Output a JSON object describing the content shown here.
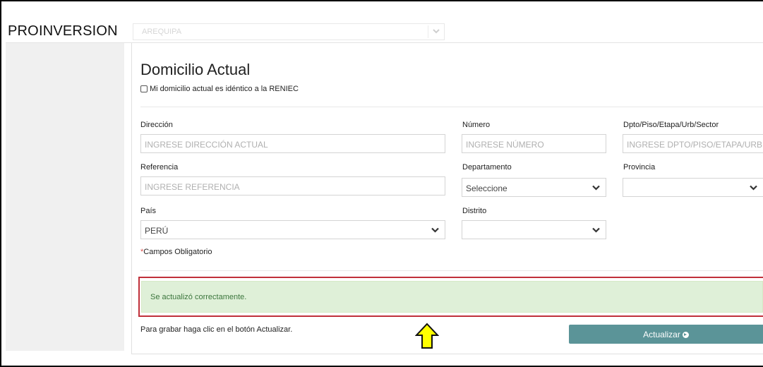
{
  "header": {
    "logo": "PROINVERSION",
    "top_select_value": "AREQUIPA"
  },
  "section": {
    "title": "Domicilio Actual",
    "checkbox_label": "Mi domicilio actual es idéntico a la RENIEC",
    "checkbox_checked": false
  },
  "form": {
    "direccion": {
      "label": "Dirección",
      "placeholder": "INGRESE DIRECCIÓN ACTUAL"
    },
    "numero": {
      "label": "Número",
      "placeholder": "INGRESE NÚMERO"
    },
    "dpto": {
      "label": "Dpto/Piso/Etapa/Urb/Sector",
      "placeholder": "INGRESE DPTO/PISO/ETAPA/URB Ó SECTOR"
    },
    "referencia": {
      "label": "Referencia",
      "placeholder": "INGRESE REFERENCIA"
    },
    "departamento": {
      "label": "Departamento",
      "value": "Seleccione"
    },
    "provincia": {
      "label": "Provincia",
      "value": ""
    },
    "pais": {
      "label": "País",
      "value": "PERÚ"
    },
    "distrito": {
      "label": "Distrito",
      "value": ""
    },
    "required_star": "*",
    "required_note": "Campos Obligatorio"
  },
  "alert": {
    "message": "Se actualizó correctamente.",
    "color": "#dff0d8"
  },
  "footer": {
    "hint": "Para grabar haga clic en el botón Actualizar.",
    "button_label": "Actualizar",
    "button_color": "#5b9498"
  },
  "icons": {
    "dropdown": "chevron-down-icon",
    "button": "arrow-circle-right-icon",
    "annotation": "up-arrow-icon"
  }
}
